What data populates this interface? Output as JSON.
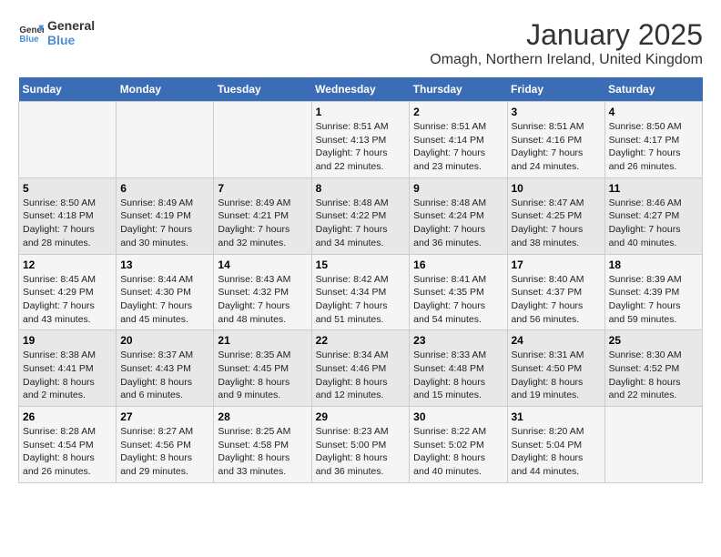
{
  "logo": {
    "line1": "General",
    "line2": "Blue"
  },
  "title": "January 2025",
  "subtitle": "Omagh, Northern Ireland, United Kingdom",
  "weekdays": [
    "Sunday",
    "Monday",
    "Tuesday",
    "Wednesday",
    "Thursday",
    "Friday",
    "Saturday"
  ],
  "weeks": [
    [
      {
        "day": "",
        "info": ""
      },
      {
        "day": "",
        "info": ""
      },
      {
        "day": "",
        "info": ""
      },
      {
        "day": "1",
        "info": "Sunrise: 8:51 AM\nSunset: 4:13 PM\nDaylight: 7 hours\nand 22 minutes."
      },
      {
        "day": "2",
        "info": "Sunrise: 8:51 AM\nSunset: 4:14 PM\nDaylight: 7 hours\nand 23 minutes."
      },
      {
        "day": "3",
        "info": "Sunrise: 8:51 AM\nSunset: 4:16 PM\nDaylight: 7 hours\nand 24 minutes."
      },
      {
        "day": "4",
        "info": "Sunrise: 8:50 AM\nSunset: 4:17 PM\nDaylight: 7 hours\nand 26 minutes."
      }
    ],
    [
      {
        "day": "5",
        "info": "Sunrise: 8:50 AM\nSunset: 4:18 PM\nDaylight: 7 hours\nand 28 minutes."
      },
      {
        "day": "6",
        "info": "Sunrise: 8:49 AM\nSunset: 4:19 PM\nDaylight: 7 hours\nand 30 minutes."
      },
      {
        "day": "7",
        "info": "Sunrise: 8:49 AM\nSunset: 4:21 PM\nDaylight: 7 hours\nand 32 minutes."
      },
      {
        "day": "8",
        "info": "Sunrise: 8:48 AM\nSunset: 4:22 PM\nDaylight: 7 hours\nand 34 minutes."
      },
      {
        "day": "9",
        "info": "Sunrise: 8:48 AM\nSunset: 4:24 PM\nDaylight: 7 hours\nand 36 minutes."
      },
      {
        "day": "10",
        "info": "Sunrise: 8:47 AM\nSunset: 4:25 PM\nDaylight: 7 hours\nand 38 minutes."
      },
      {
        "day": "11",
        "info": "Sunrise: 8:46 AM\nSunset: 4:27 PM\nDaylight: 7 hours\nand 40 minutes."
      }
    ],
    [
      {
        "day": "12",
        "info": "Sunrise: 8:45 AM\nSunset: 4:29 PM\nDaylight: 7 hours\nand 43 minutes."
      },
      {
        "day": "13",
        "info": "Sunrise: 8:44 AM\nSunset: 4:30 PM\nDaylight: 7 hours\nand 45 minutes."
      },
      {
        "day": "14",
        "info": "Sunrise: 8:43 AM\nSunset: 4:32 PM\nDaylight: 7 hours\nand 48 minutes."
      },
      {
        "day": "15",
        "info": "Sunrise: 8:42 AM\nSunset: 4:34 PM\nDaylight: 7 hours\nand 51 minutes."
      },
      {
        "day": "16",
        "info": "Sunrise: 8:41 AM\nSunset: 4:35 PM\nDaylight: 7 hours\nand 54 minutes."
      },
      {
        "day": "17",
        "info": "Sunrise: 8:40 AM\nSunset: 4:37 PM\nDaylight: 7 hours\nand 56 minutes."
      },
      {
        "day": "18",
        "info": "Sunrise: 8:39 AM\nSunset: 4:39 PM\nDaylight: 7 hours\nand 59 minutes."
      }
    ],
    [
      {
        "day": "19",
        "info": "Sunrise: 8:38 AM\nSunset: 4:41 PM\nDaylight: 8 hours\nand 2 minutes."
      },
      {
        "day": "20",
        "info": "Sunrise: 8:37 AM\nSunset: 4:43 PM\nDaylight: 8 hours\nand 6 minutes."
      },
      {
        "day": "21",
        "info": "Sunrise: 8:35 AM\nSunset: 4:45 PM\nDaylight: 8 hours\nand 9 minutes."
      },
      {
        "day": "22",
        "info": "Sunrise: 8:34 AM\nSunset: 4:46 PM\nDaylight: 8 hours\nand 12 minutes."
      },
      {
        "day": "23",
        "info": "Sunrise: 8:33 AM\nSunset: 4:48 PM\nDaylight: 8 hours\nand 15 minutes."
      },
      {
        "day": "24",
        "info": "Sunrise: 8:31 AM\nSunset: 4:50 PM\nDaylight: 8 hours\nand 19 minutes."
      },
      {
        "day": "25",
        "info": "Sunrise: 8:30 AM\nSunset: 4:52 PM\nDaylight: 8 hours\nand 22 minutes."
      }
    ],
    [
      {
        "day": "26",
        "info": "Sunrise: 8:28 AM\nSunset: 4:54 PM\nDaylight: 8 hours\nand 26 minutes."
      },
      {
        "day": "27",
        "info": "Sunrise: 8:27 AM\nSunset: 4:56 PM\nDaylight: 8 hours\nand 29 minutes."
      },
      {
        "day": "28",
        "info": "Sunrise: 8:25 AM\nSunset: 4:58 PM\nDaylight: 8 hours\nand 33 minutes."
      },
      {
        "day": "29",
        "info": "Sunrise: 8:23 AM\nSunset: 5:00 PM\nDaylight: 8 hours\nand 36 minutes."
      },
      {
        "day": "30",
        "info": "Sunrise: 8:22 AM\nSunset: 5:02 PM\nDaylight: 8 hours\nand 40 minutes."
      },
      {
        "day": "31",
        "info": "Sunrise: 8:20 AM\nSunset: 5:04 PM\nDaylight: 8 hours\nand 44 minutes."
      },
      {
        "day": "",
        "info": ""
      }
    ]
  ]
}
